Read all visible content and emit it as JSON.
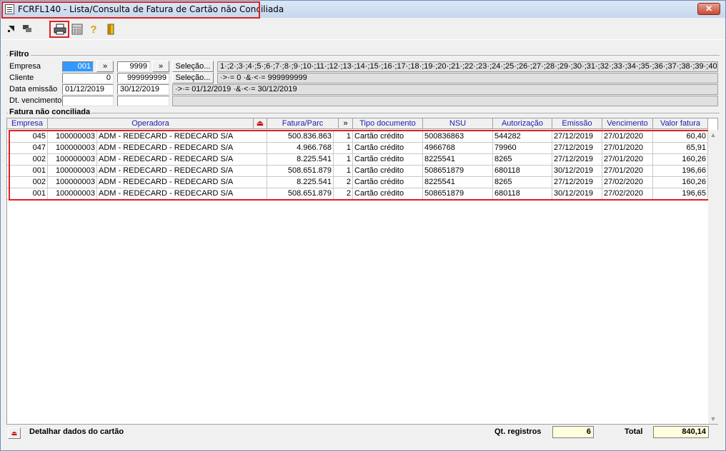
{
  "window": {
    "title": "FCRFL140 - Lista/Consulta de Fatura de Cartão não Conciliada",
    "close_glyph": "✕"
  },
  "toolbar": {
    "icons": [
      "arrow-out-icon",
      "arrow-in-icon",
      "printer-icon",
      "calculator-icon",
      "help-icon",
      "exit-door-icon"
    ]
  },
  "filtro": {
    "legend": "Filtro",
    "empresa": {
      "label": "Empresa",
      "from": "001",
      "nav": "»",
      "to": "9999",
      "nav2": "»",
      "button": "Seleção...",
      "info": "1·;2·;3·;4·;5·;6·;7·;8·;9·;10·;11·;12·;13·;14·;15·;16·;17·;18·;19·;20·;21·;22·;23·;24·;25·;26·;27·;28·;29·;30·;31·;32·;33·;34·;35·;36·;37·;38·;39·;40"
    },
    "cliente": {
      "label": "Cliente",
      "from": "0",
      "to": "999999999",
      "button": "Seleção...",
      "info": "·>·= 0 ·&·<·= 999999999"
    },
    "data_emissao": {
      "label": "Data emissão",
      "from": "01/12/2019",
      "to": "30/12/2019",
      "info": "·>·= 01/12/2019 ·&·<·= 30/12/2019"
    },
    "dt_vencimento": {
      "label": "Dt. vencimento",
      "from": "",
      "to": "",
      "info": ""
    }
  },
  "fatura": {
    "legend": "Fatura não conciliada",
    "columns": [
      "Empresa",
      "Operadora",
      "",
      "Fatura/Parc",
      "»",
      "Tipo documento",
      "NSU",
      "Autorização",
      "Emissão",
      "Vencimento",
      "Valor fatura"
    ],
    "sort_glyph": "⏏",
    "rows": [
      [
        "045",
        "100000003",
        "ADM - REDECARD - REDECARD S/A",
        "500.836.863",
        "1",
        "Cartão crédito",
        "500836863",
        "544282",
        "27/12/2019",
        "27/01/2020",
        "60,40"
      ],
      [
        "047",
        "100000003",
        "ADM - REDECARD - REDECARD S/A",
        "4.966.768",
        "1",
        "Cartão crédito",
        "4966768",
        "79960",
        "27/12/2019",
        "27/01/2020",
        "65,91"
      ],
      [
        "002",
        "100000003",
        "ADM - REDECARD - REDECARD S/A",
        "8.225.541",
        "1",
        "Cartão crédito",
        "8225541",
        "8265",
        "27/12/2019",
        "27/01/2020",
        "160,26"
      ],
      [
        "001",
        "100000003",
        "ADM - REDECARD - REDECARD S/A",
        "508.651.879",
        "1",
        "Cartão crédito",
        "508651879",
        "680118",
        "30/12/2019",
        "27/01/2020",
        "196,66"
      ],
      [
        "002",
        "100000003",
        "ADM - REDECARD - REDECARD S/A",
        "8.225.541",
        "2",
        "Cartão crédito",
        "8225541",
        "8265",
        "27/12/2019",
        "27/02/2020",
        "160,26"
      ],
      [
        "001",
        "100000003",
        "ADM - REDECARD - REDECARD S/A",
        "508.651.879",
        "2",
        "Cartão crédito",
        "508651879",
        "680118",
        "30/12/2019",
        "27/02/2020",
        "196,65"
      ]
    ]
  },
  "footer": {
    "detail_label": "Detalhar dados do cartão",
    "count_label": "Qt. registros",
    "count_value": "6",
    "total_label": "Total",
    "total_value": "840,14"
  }
}
